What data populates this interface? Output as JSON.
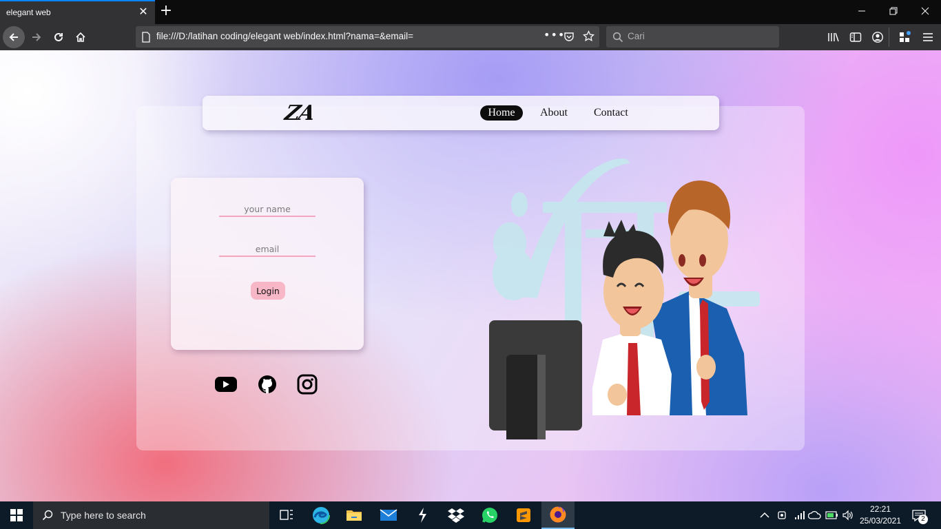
{
  "browser": {
    "tab_title": "elegant web",
    "url": "file:///D:/latihan coding/elegant web/index.html?nama=&email=",
    "search_placeholder": "Cari"
  },
  "site": {
    "logo": "ZA",
    "nav": [
      "Home",
      "About",
      "Contact"
    ],
    "active_nav": "Home",
    "form": {
      "name_placeholder": "your name",
      "email_placeholder": "email",
      "login_label": "Login"
    },
    "social_icons": [
      "youtube-icon",
      "github-icon",
      "instagram-icon"
    ]
  },
  "taskbar": {
    "search_placeholder": "Type here to search",
    "time": "22:21",
    "date": "25/03/2021",
    "notification_count": "2"
  },
  "colors": {
    "accent_pink": "#f7b7c7",
    "field_underline": "#f4a6bf",
    "tab_highlight": "#0a84ff"
  }
}
